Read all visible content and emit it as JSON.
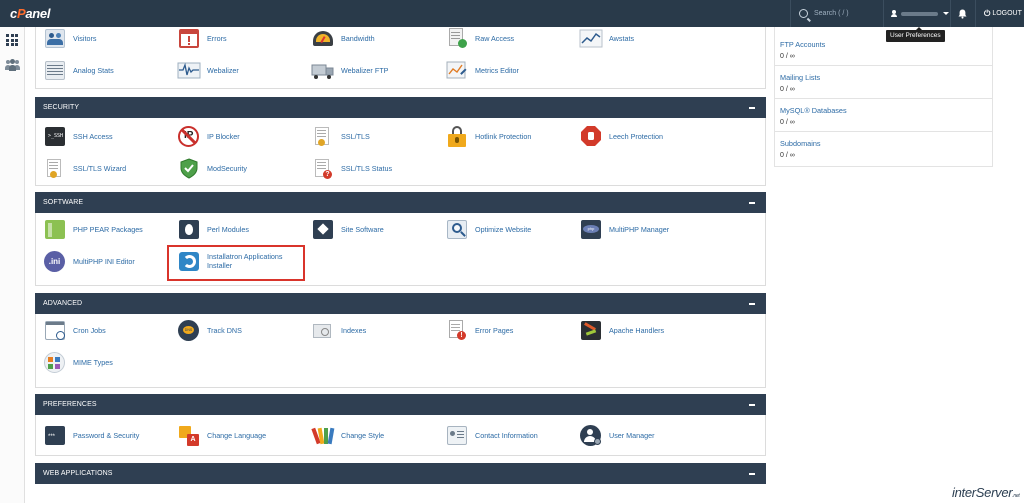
{
  "topbar": {
    "logo_text": "cPanel",
    "search_placeholder": "Search ( / )",
    "logout_label": "LOGOUT",
    "tooltip": "User Preferences"
  },
  "sections": {
    "metrics": {
      "items": [
        "Visitors",
        "Errors",
        "Bandwidth",
        "Raw Access",
        "Awstats",
        "Analog Stats",
        "Webalizer",
        "Webalizer FTP",
        "Metrics Editor"
      ]
    },
    "security": {
      "title": "SECURITY",
      "items": [
        "SSH Access",
        "IP Blocker",
        "SSL/TLS",
        "Hotlink Protection",
        "Leech Protection",
        "SSL/TLS Wizard",
        "ModSecurity",
        "SSL/TLS Status"
      ]
    },
    "software": {
      "title": "SOFTWARE",
      "items": [
        "PHP PEAR Packages",
        "Perl Modules",
        "Site Software",
        "Optimize Website",
        "MultiPHP Manager",
        "MultiPHP INI Editor",
        "Installatron Applications",
        "Installer"
      ]
    },
    "advanced": {
      "title": "ADVANCED",
      "items": [
        "Cron Jobs",
        "Track DNS",
        "Indexes",
        "Error Pages",
        "Apache Handlers",
        "MIME Types"
      ]
    },
    "preferences": {
      "title": "PREFERENCES",
      "items": [
        "Password & Security",
        "Change Language",
        "Change Style",
        "Contact Information",
        "User Manager"
      ]
    },
    "web_applications": {
      "title": "WEB APPLICATIONS"
    }
  },
  "stats": [
    {
      "label": "FTP Accounts",
      "value": "0 / ∞"
    },
    {
      "label": "Mailing Lists",
      "value": "0 / ∞"
    },
    {
      "label": "MySQL® Databases",
      "value": "0 / ∞"
    },
    {
      "label": "Subdomains",
      "value": "0 / ∞"
    }
  ],
  "footer_logo": {
    "text": "interServer",
    "suffix": ".net"
  },
  "colors": {
    "header_bg": "#293a4a",
    "panel_head_bg": "#2f3f52",
    "link": "#2d6ba5",
    "highlight": "#d9342b"
  }
}
